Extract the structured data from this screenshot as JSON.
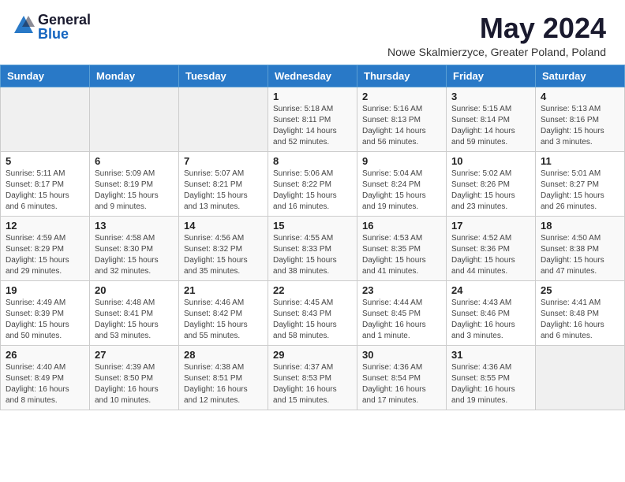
{
  "header": {
    "logo_general": "General",
    "logo_blue": "Blue",
    "month_title": "May 2024",
    "subtitle": "Nowe Skalmierzyce, Greater Poland, Poland"
  },
  "calendar": {
    "headers": [
      "Sunday",
      "Monday",
      "Tuesday",
      "Wednesday",
      "Thursday",
      "Friday",
      "Saturday"
    ],
    "weeks": [
      [
        {
          "day": "",
          "info": ""
        },
        {
          "day": "",
          "info": ""
        },
        {
          "day": "",
          "info": ""
        },
        {
          "day": "1",
          "info": "Sunrise: 5:18 AM\nSunset: 8:11 PM\nDaylight: 14 hours and 52 minutes."
        },
        {
          "day": "2",
          "info": "Sunrise: 5:16 AM\nSunset: 8:13 PM\nDaylight: 14 hours and 56 minutes."
        },
        {
          "day": "3",
          "info": "Sunrise: 5:15 AM\nSunset: 8:14 PM\nDaylight: 14 hours and 59 minutes."
        },
        {
          "day": "4",
          "info": "Sunrise: 5:13 AM\nSunset: 8:16 PM\nDaylight: 15 hours and 3 minutes."
        }
      ],
      [
        {
          "day": "5",
          "info": "Sunrise: 5:11 AM\nSunset: 8:17 PM\nDaylight: 15 hours and 6 minutes."
        },
        {
          "day": "6",
          "info": "Sunrise: 5:09 AM\nSunset: 8:19 PM\nDaylight: 15 hours and 9 minutes."
        },
        {
          "day": "7",
          "info": "Sunrise: 5:07 AM\nSunset: 8:21 PM\nDaylight: 15 hours and 13 minutes."
        },
        {
          "day": "8",
          "info": "Sunrise: 5:06 AM\nSunset: 8:22 PM\nDaylight: 15 hours and 16 minutes."
        },
        {
          "day": "9",
          "info": "Sunrise: 5:04 AM\nSunset: 8:24 PM\nDaylight: 15 hours and 19 minutes."
        },
        {
          "day": "10",
          "info": "Sunrise: 5:02 AM\nSunset: 8:26 PM\nDaylight: 15 hours and 23 minutes."
        },
        {
          "day": "11",
          "info": "Sunrise: 5:01 AM\nSunset: 8:27 PM\nDaylight: 15 hours and 26 minutes."
        }
      ],
      [
        {
          "day": "12",
          "info": "Sunrise: 4:59 AM\nSunset: 8:29 PM\nDaylight: 15 hours and 29 minutes."
        },
        {
          "day": "13",
          "info": "Sunrise: 4:58 AM\nSunset: 8:30 PM\nDaylight: 15 hours and 32 minutes."
        },
        {
          "day": "14",
          "info": "Sunrise: 4:56 AM\nSunset: 8:32 PM\nDaylight: 15 hours and 35 minutes."
        },
        {
          "day": "15",
          "info": "Sunrise: 4:55 AM\nSunset: 8:33 PM\nDaylight: 15 hours and 38 minutes."
        },
        {
          "day": "16",
          "info": "Sunrise: 4:53 AM\nSunset: 8:35 PM\nDaylight: 15 hours and 41 minutes."
        },
        {
          "day": "17",
          "info": "Sunrise: 4:52 AM\nSunset: 8:36 PM\nDaylight: 15 hours and 44 minutes."
        },
        {
          "day": "18",
          "info": "Sunrise: 4:50 AM\nSunset: 8:38 PM\nDaylight: 15 hours and 47 minutes."
        }
      ],
      [
        {
          "day": "19",
          "info": "Sunrise: 4:49 AM\nSunset: 8:39 PM\nDaylight: 15 hours and 50 minutes."
        },
        {
          "day": "20",
          "info": "Sunrise: 4:48 AM\nSunset: 8:41 PM\nDaylight: 15 hours and 53 minutes."
        },
        {
          "day": "21",
          "info": "Sunrise: 4:46 AM\nSunset: 8:42 PM\nDaylight: 15 hours and 55 minutes."
        },
        {
          "day": "22",
          "info": "Sunrise: 4:45 AM\nSunset: 8:43 PM\nDaylight: 15 hours and 58 minutes."
        },
        {
          "day": "23",
          "info": "Sunrise: 4:44 AM\nSunset: 8:45 PM\nDaylight: 16 hours and 1 minute."
        },
        {
          "day": "24",
          "info": "Sunrise: 4:43 AM\nSunset: 8:46 PM\nDaylight: 16 hours and 3 minutes."
        },
        {
          "day": "25",
          "info": "Sunrise: 4:41 AM\nSunset: 8:48 PM\nDaylight: 16 hours and 6 minutes."
        }
      ],
      [
        {
          "day": "26",
          "info": "Sunrise: 4:40 AM\nSunset: 8:49 PM\nDaylight: 16 hours and 8 minutes."
        },
        {
          "day": "27",
          "info": "Sunrise: 4:39 AM\nSunset: 8:50 PM\nDaylight: 16 hours and 10 minutes."
        },
        {
          "day": "28",
          "info": "Sunrise: 4:38 AM\nSunset: 8:51 PM\nDaylight: 16 hours and 12 minutes."
        },
        {
          "day": "29",
          "info": "Sunrise: 4:37 AM\nSunset: 8:53 PM\nDaylight: 16 hours and 15 minutes."
        },
        {
          "day": "30",
          "info": "Sunrise: 4:36 AM\nSunset: 8:54 PM\nDaylight: 16 hours and 17 minutes."
        },
        {
          "day": "31",
          "info": "Sunrise: 4:36 AM\nSunset: 8:55 PM\nDaylight: 16 hours and 19 minutes."
        },
        {
          "day": "",
          "info": ""
        }
      ]
    ]
  }
}
